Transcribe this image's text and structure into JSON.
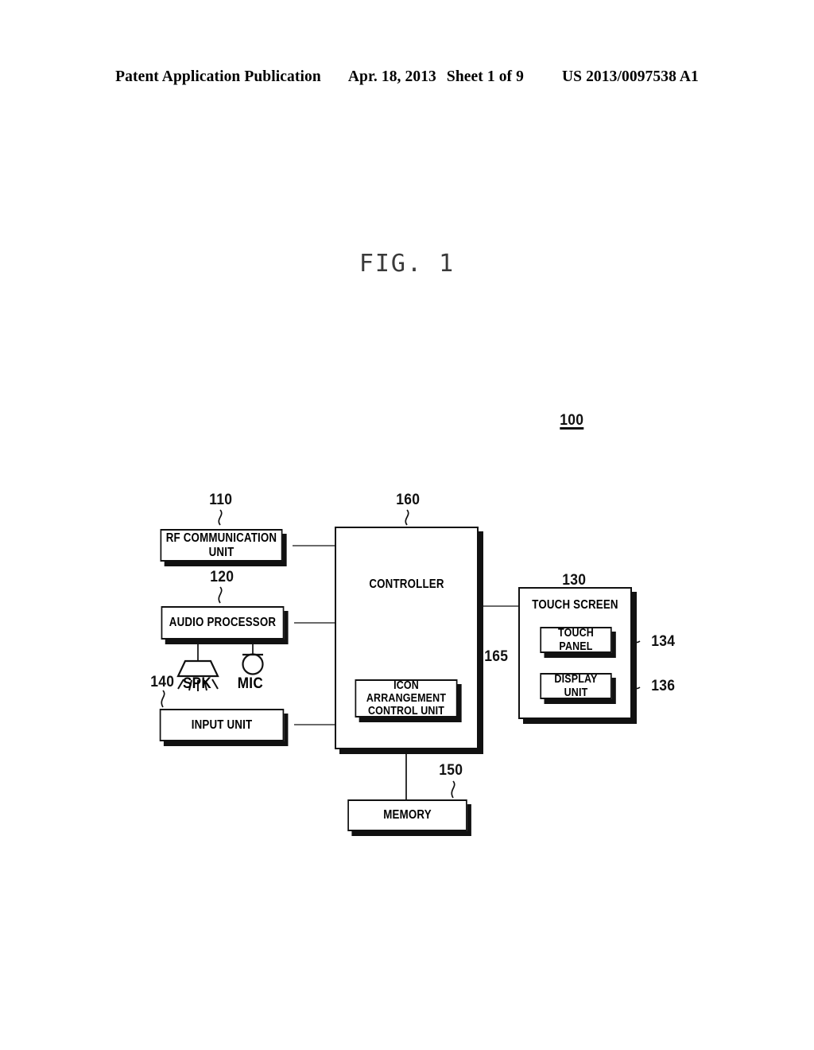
{
  "header": {
    "publication": "Patent Application Publication",
    "date": "Apr. 18, 2013",
    "sheet": "Sheet 1 of 9",
    "patent_number": "US 2013/0097538 A1"
  },
  "figure": {
    "title": "FIG. 1",
    "system_ref": "100"
  },
  "blocks": {
    "rf_communication_unit": {
      "label": "RF COMMUNICATION UNIT",
      "ref": "110"
    },
    "audio_processor": {
      "label": "AUDIO PROCESSOR",
      "ref": "120"
    },
    "input_unit": {
      "label": "INPUT UNIT",
      "ref": "140"
    },
    "controller": {
      "label": "CONTROLLER",
      "ref": "160"
    },
    "icon_arrangement_control_unit": {
      "label": "ICON ARRANGEMENT\nCONTROL UNIT",
      "ref": "165"
    },
    "memory": {
      "label": "MEMORY",
      "ref": "150"
    },
    "touch_screen": {
      "label": "TOUCH SCREEN",
      "ref": "130"
    },
    "touch_panel": {
      "label": "TOUCH PANEL",
      "ref": "134"
    },
    "display_unit": {
      "label": "DISPLAY UNIT",
      "ref": "136"
    }
  },
  "devices": {
    "speaker": {
      "label": "SPK"
    },
    "microphone": {
      "label": "MIC"
    }
  },
  "colors": {
    "ink": "#111111",
    "connector": "#555555",
    "title": "#3a3a3a"
  }
}
